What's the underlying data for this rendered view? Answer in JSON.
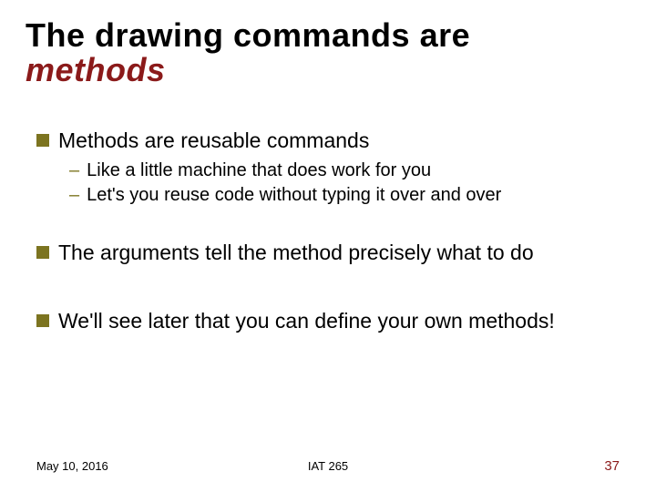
{
  "title": {
    "line1": "The drawing commands are",
    "line2": "methods"
  },
  "bullets": [
    {
      "text": "Methods are reusable commands",
      "subs": [
        "Like a little machine that does work for you",
        "Let's you reuse code without typing it over and over"
      ]
    },
    {
      "text": "The arguments tell the method precisely what to do",
      "subs": []
    },
    {
      "text": "We'll see later that you can define your own methods!",
      "subs": []
    }
  ],
  "footer": {
    "date": "May 10, 2016",
    "course": "IAT 265",
    "page": "37"
  }
}
